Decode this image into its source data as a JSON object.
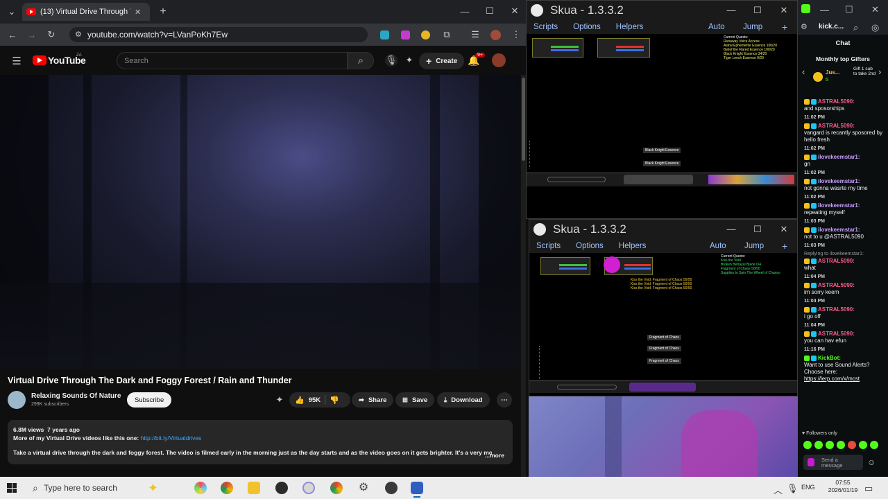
{
  "chrome": {
    "tab_title": "(13) Virtual Drive Through T",
    "url": "youtube.com/watch?v=LVanPoKh7Ew"
  },
  "youtube": {
    "logo": "YouTube",
    "logo_super": "ZA",
    "search_placeholder": "Search",
    "create_label": "Create",
    "notif_count": "9+",
    "video_title": "Virtual Drive Through The Dark and Foggy Forest / Rain and Thunder",
    "channel_name": "Relaxing Sounds Of Nature",
    "subscribers": "299K subscribers",
    "subscribe_label": "Subscribe",
    "likes": "95K",
    "share_label": "Share",
    "save_label": "Save",
    "download_label": "Download",
    "views": "6.8M views",
    "age": "7 years ago",
    "desc_line1": "More of my Virtual Drive videos like this one: ",
    "desc_link": "http://bit.ly/Virtualdrives",
    "desc_line2": "Take a virtual drive through the dark and foggy forest. The video is filmed early in the morning just as the day starts and as the video goes on it gets brighter. It's a very moo",
    "more_label": "...more"
  },
  "skua1": {
    "title": "Skua - 1.3.3.2",
    "menu": [
      "Scripts",
      "Options",
      "Helpers"
    ],
    "right_menu": [
      "Auto",
      "Jump",
      "+"
    ],
    "quests_title": "Current Quests:",
    "quests": [
      "Runaway Voice Access",
      "Astral Ephemerite Essence 100/20",
      "Belief the Flared Essence 100/20",
      "Black Knight Essence 34/20",
      "Tiger Leech Essence 0/20"
    ],
    "drops": [
      "Black Knight Essence",
      "Black Knight Essence"
    ]
  },
  "skua2": {
    "title": "Skua - 1.3.3.2",
    "menu": [
      "Scripts",
      "Options",
      "Helpers"
    ],
    "right_menu": [
      "Auto",
      "Jump",
      "+"
    ],
    "quests_title": "Current Quests:",
    "quests": [
      "Kiss the Void",
      "Broken Betrayal Blade 0/4",
      "Fragment of Chaos 50/50",
      "Supplies to Spin The Wheel of Chance"
    ],
    "center_lines": [
      "Kiss the Void: Fragment of Chaos 50/50",
      "Kiss the Void: Fragment of Chaos 50/50",
      "Kiss the Void: Fragment of Chaos 50/50"
    ],
    "drops": [
      "Fragment of Chaos",
      "Fragment of Chaos",
      "Fragment of Chaos"
    ]
  },
  "kick": {
    "url": "kick.c...",
    "chat_label": "Chat",
    "gifters_label": "Monthly top Gifters",
    "gifter_name": "Jus...",
    "gifter_count": "5",
    "gift_promo": "Gift 1 sub to take 2nd",
    "messages": [
      {
        "time": "",
        "user": "ASTRAL5090:",
        "text": "and sposorships"
      },
      {
        "time": "11:02 PM",
        "user": "ASTRAL5090:",
        "text": "vangard is recantly sposored by hello fresh"
      },
      {
        "time": "11:02 PM",
        "user": "ilovekeemstar1:",
        "text": "gn"
      },
      {
        "time": "11:02 PM",
        "user": "ilovekeemstar1:",
        "text": "not gonna wasrte my time"
      },
      {
        "time": "11:02 PM",
        "user": "ilovekeemstar1:",
        "text": "repeating myself"
      },
      {
        "time": "11:03 PM",
        "user": "ilovekeemstar1:",
        "text": "not to u @ASTRAL5090"
      },
      {
        "time": "11:03 PM",
        "user": "ASTRAL5090:",
        "text": "what",
        "reply": "Replying to ilovekeemstar1:"
      },
      {
        "time": "11:04 PM",
        "user": "ASTRAL5090:",
        "text": "im sorry keem"
      },
      {
        "time": "11:04 PM",
        "user": "ASTRAL5090:",
        "text": "i go off"
      },
      {
        "time": "11:04 PM",
        "user": "ASTRAL5090:",
        "text": "you can hav efun"
      },
      {
        "time": "11:16 PM",
        "user": "KickBot:",
        "text": "Want to use Sound Alerts? Choose here: ",
        "link": "https://lerp.com/x/mcst"
      }
    ],
    "followers_only": "Followers only",
    "send_placeholder": "Send a message"
  },
  "taskbar": {
    "search_placeholder": "Type here to search",
    "lang": "ENG",
    "time": "07:55",
    "date": "2026/01/19"
  }
}
